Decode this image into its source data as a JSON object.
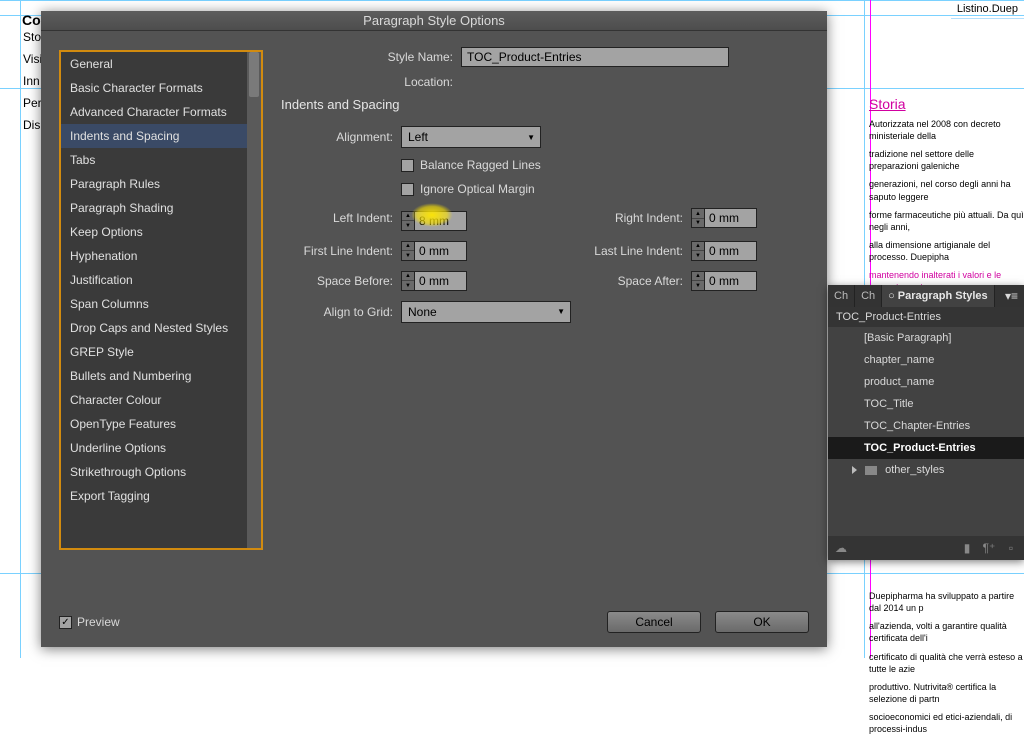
{
  "doc": {
    "title_right": "Listino.Duep",
    "co": "Co",
    "left_items": [
      "Sto",
      "Visi",
      "Inn",
      "Per",
      "Dis"
    ],
    "storia": {
      "heading": "Storia",
      "p1": "Autorizzata nel 2008 con decreto ministeriale della",
      "p2": "tradizione nel settore delle preparazioni galeniche",
      "p3": "generazioni, nel corso degli anni ha saputo leggere",
      "p4": "forme farmaceutiche più attuali. Da quì negli anni,",
      "p5": "alla dimensione artigianale del processo. Duepipha",
      "p6": "mantenendo inalterati i valori e le competenze tras"
    },
    "vision_heading": "Vision",
    "bottom": {
      "p1": "Duepipharma ha sviluppato a partire dal 2014 un p",
      "p2": "all'azienda, volti a garantire qualità certificata dell'i",
      "p3": "certificato di qualità che verrà esteso a tutte le azie",
      "p4": "produttivo. Nutrivita® certifica la selezione di partn",
      "p5": "socioeconomici ed etici-aziendali, di processi-indus"
    }
  },
  "dialog": {
    "title": "Paragraph Style Options",
    "sidebar": [
      "General",
      "Basic Character Formats",
      "Advanced Character Formats",
      "Indents and Spacing",
      "Tabs",
      "Paragraph Rules",
      "Paragraph Shading",
      "Keep Options",
      "Hyphenation",
      "Justification",
      "Span Columns",
      "Drop Caps and Nested Styles",
      "GREP Style",
      "Bullets and Numbering",
      "Character Colour",
      "OpenType Features",
      "Underline Options",
      "Strikethrough Options",
      "Export Tagging"
    ],
    "sidebar_selected": 3,
    "style_name_label": "Style Name:",
    "style_name_value": "TOC_Product-Entries",
    "location_label": "Location:",
    "section_heading": "Indents and Spacing",
    "alignment_label": "Alignment:",
    "alignment_value": "Left",
    "balance_label": "Balance Ragged Lines",
    "ignore_label": "Ignore Optical Margin",
    "left_indent_label": "Left Indent:",
    "left_indent_value": "8 mm",
    "right_indent_label": "Right Indent:",
    "right_indent_value": "0 mm",
    "first_line_label": "First Line Indent:",
    "first_line_value": "0 mm",
    "last_line_label": "Last Line Indent:",
    "last_line_value": "0 mm",
    "space_before_label": "Space Before:",
    "space_before_value": "0 mm",
    "space_after_label": "Space After:",
    "space_after_value": "0 mm",
    "align_grid_label": "Align to Grid:",
    "align_grid_value": "None",
    "preview_label": "Preview",
    "cancel_label": "Cancel",
    "ok_label": "OK"
  },
  "panel": {
    "tabs": [
      "Ch",
      "Ch",
      "Paragraph Styles"
    ],
    "header": "TOC_Product-Entries",
    "items": [
      {
        "label": "[Basic Paragraph]",
        "indent": 1
      },
      {
        "label": "chapter_name",
        "indent": 1
      },
      {
        "label": "product_name",
        "indent": 1
      },
      {
        "label": "TOC_Title",
        "indent": 1
      },
      {
        "label": "TOC_Chapter-Entries",
        "indent": 1
      },
      {
        "label": "TOC_Product-Entries",
        "indent": 1,
        "selected": true
      },
      {
        "label": "other_styles",
        "indent": 0,
        "folder": true
      }
    ]
  }
}
